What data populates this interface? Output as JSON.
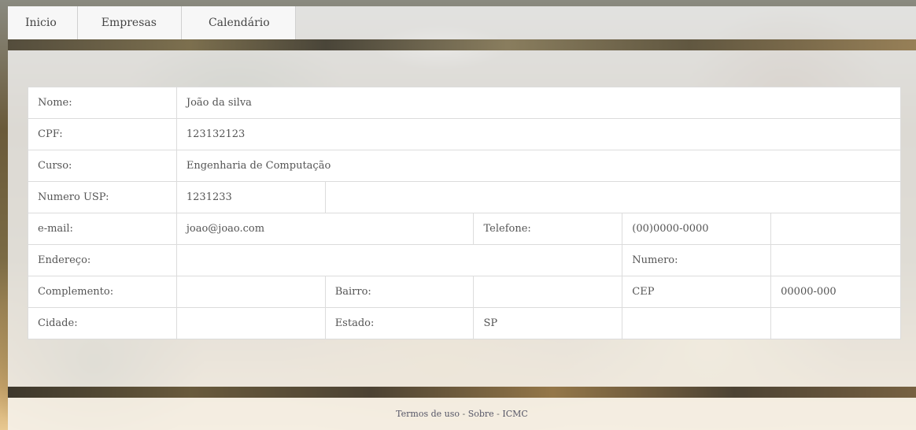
{
  "nav": {
    "items": [
      {
        "label": "Inicio"
      },
      {
        "label": "Empresas"
      },
      {
        "label": "Calendário"
      }
    ]
  },
  "profile": {
    "nome_label": "Nome:",
    "nome_value": "João da silva",
    "cpf_label": "CPF:",
    "cpf_value": "123132123",
    "curso_label": "Curso:",
    "curso_value": "Engenharia de Computação",
    "numero_usp_label": "Numero USP:",
    "numero_usp_value": "1231233",
    "email_label": "e-mail:",
    "email_value": "joao@joao.com",
    "telefone_label": "Telefone:",
    "telefone_value": "(00)0000-0000",
    "endereco_label": "Endereço:",
    "numero_label": "Numero:",
    "complemento_label": "Complemento:",
    "bairro_label": "Bairro:",
    "cep_label": "CEP",
    "cep_value": "00000-000",
    "cidade_label": "Cidade:",
    "estado_label": "Estado:",
    "estado_value": "SP"
  },
  "footer": {
    "termos": "Termos de uso",
    "sep1": " - ",
    "sobre": "Sobre",
    "sep2": " - ",
    "icmc": "ICMC"
  }
}
